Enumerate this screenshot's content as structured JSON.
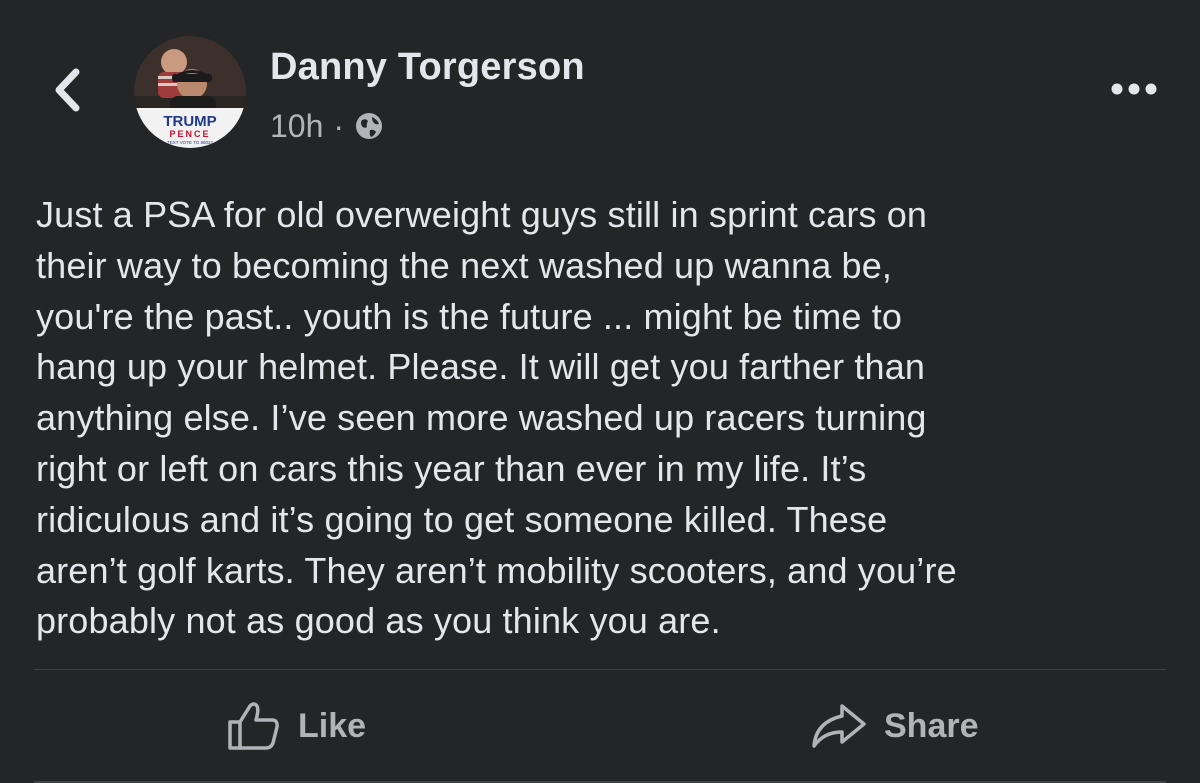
{
  "post": {
    "author_name": "Danny Torgerson",
    "timestamp": "10h",
    "separator": "·",
    "audience_icon": "globe-icon",
    "body": "Just a PSA for old overweight guys still in sprint cars on\ntheir way to becoming the next washed up wanna be,\nyou're the past.. youth is the future ... might be time to\nhang up your helmet. Please. It will get you farther than\nanything else. I’ve seen more washed up racers turning\nright or left on cars this year than ever in my life. It’s\nridiculous and it’s going to get someone killed. These\naren’t golf karts. They aren’t mobility scooters, and you’re\nprobably not as good as you think you are."
  },
  "avatar": {
    "badge_line1": "TRUMP",
    "badge_line2": "PENCE",
    "badge_line3": "TEXT VOTE TO 88022"
  },
  "actions": {
    "like_label": "Like",
    "share_label": "Share"
  },
  "colors": {
    "background": "#242526",
    "primary_text": "#e4e6eb",
    "secondary_text": "#b0b3b8",
    "divider": "#3e4042"
  }
}
